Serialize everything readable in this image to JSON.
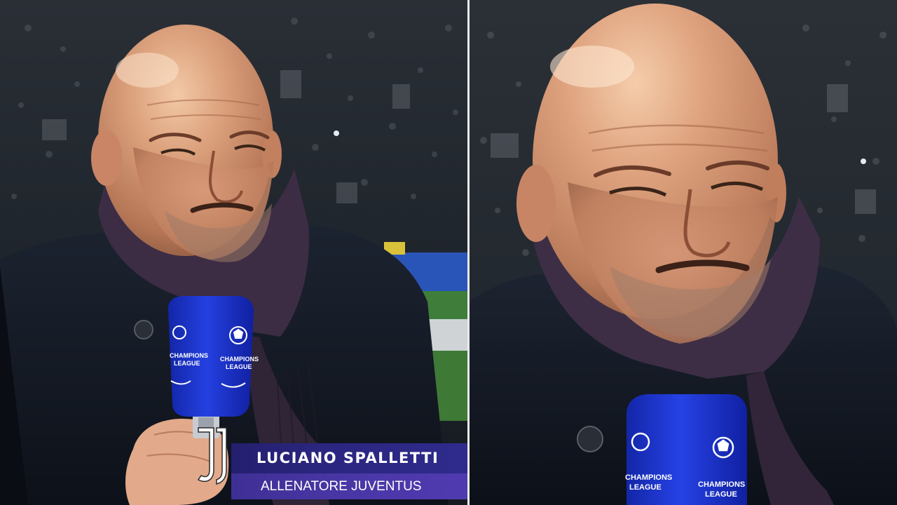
{
  "lower_third": {
    "name": "LUCIANO SPALLETTI",
    "role": "ALLENATORE JUVENTUS",
    "club_logo": "juventus-logo"
  },
  "microphone": {
    "brand_text": "CHAMPIONS LEAGUE",
    "icon": "starball-icon"
  },
  "colors": {
    "name_bar": "#2b2680",
    "role_bar": "#4a37a6",
    "microphone_blue": "#1d33c8",
    "divider": "#e9e9ea"
  }
}
